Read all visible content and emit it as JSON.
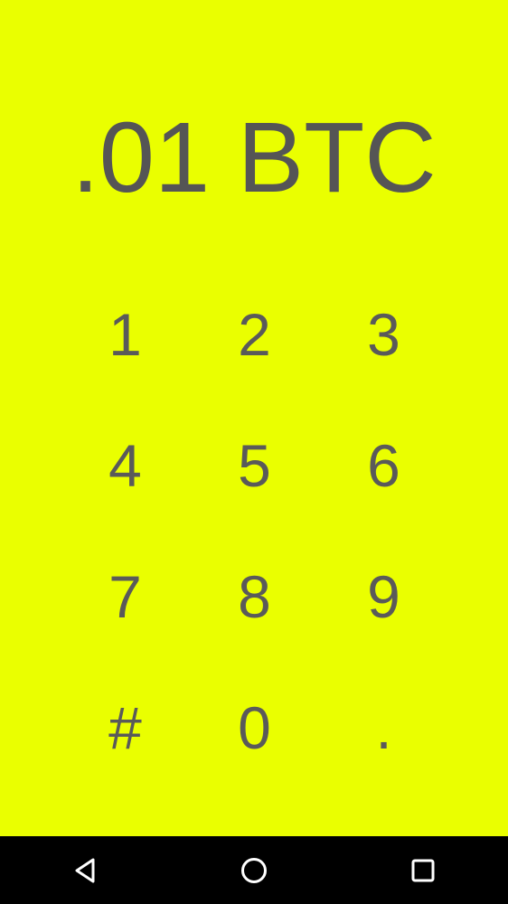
{
  "amount_display": ".01 BTC",
  "keypad": {
    "keys": [
      "1",
      "2",
      "3",
      "4",
      "5",
      "6",
      "7",
      "8",
      "9",
      "#",
      "0",
      "."
    ]
  },
  "navbar": {
    "back_icon": "triangle-back-icon",
    "home_icon": "circle-home-icon",
    "recent_icon": "square-recents-icon"
  },
  "colors": {
    "background": "#EAFF00",
    "text": "#555555",
    "navbar": "#000000",
    "nav_icon": "#FFFFFF"
  }
}
